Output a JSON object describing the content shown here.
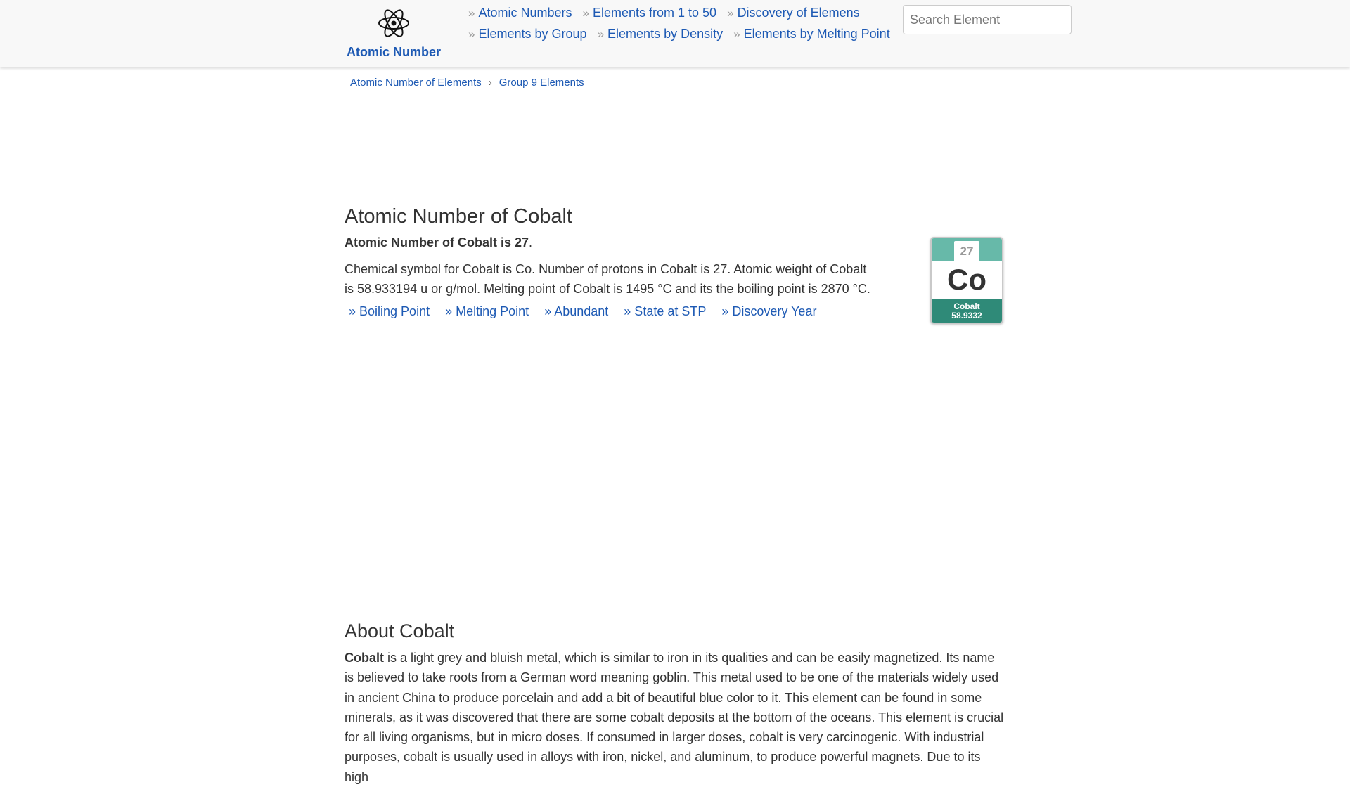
{
  "header": {
    "logo_text": "Atomic Number",
    "logo_icon": "atom-icon",
    "search_placeholder": "Search Element",
    "nav_row1": [
      "Atomic Numbers",
      "Elements from 1 to 50",
      "Discovery of Elemens"
    ],
    "nav_row2": [
      "Elements by Group",
      "Elements by Density",
      "Elements by Melting Point"
    ],
    "nav_bullet": "»"
  },
  "breadcrumb": {
    "items": [
      "Atomic Number of Elements",
      "Group 9 Elements"
    ],
    "separator": "›"
  },
  "main": {
    "title": "Atomic Number of Cobalt",
    "lead_bold": "Atomic Number of Cobalt is 27",
    "lead_tail": ".",
    "description": "Chemical symbol for Cobalt is Co. Number of protons in Cobalt is 27. Atomic weight of Cobalt is 58.933194 u or g/mol. Melting point of Cobalt is 1495 °C and its the boiling point is 2870 °C.",
    "links": [
      "» Boiling Point",
      "» Melting Point",
      "» Abundant",
      "» State at STP",
      "» Discovery Year"
    ]
  },
  "element_tile": {
    "number": "27",
    "symbol": "Co",
    "name": "Cobalt",
    "mass": "58.9332",
    "color_top": "#67b9a9",
    "color_bottom": "#2f8a78"
  },
  "about": {
    "title": "About Cobalt",
    "bold": "Cobalt",
    "text": " is a light grey and bluish metal, which is similar to iron in its qualities and can be easily magnetized. Its name is believed to take roots from a German word meaning goblin. This metal used to be one of the materials widely used in ancient China to produce porcelain and add a bit of beautiful blue color to it. This element can be found in some minerals, as it was discovered that there are some cobalt deposits at the bottom of the oceans. This element is crucial for all living organisms, but in micro doses. If consumed in larger doses, cobalt is very carcinogenic. With industrial purposes, cobalt is usually used in alloys with iron, nickel, and aluminum, to produce powerful magnets. Due to its high"
  },
  "colors": {
    "link": "#1e5ab4",
    "text": "#333333",
    "header_bg": "#f8f8f8"
  }
}
